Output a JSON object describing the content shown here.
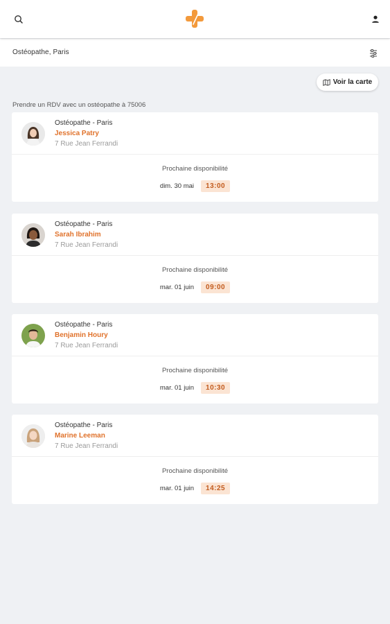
{
  "header": {
    "search_icon": "search-icon",
    "logo_icon": "medical-cross-logo",
    "user_icon": "user-icon",
    "brand_color": "#f39a3c"
  },
  "subbar": {
    "query": "Ostéopathe, Paris",
    "filter_icon": "filter-icon"
  },
  "map_button": {
    "label": "Voir la carte",
    "icon": "map-icon"
  },
  "results_label": "Prendre un RDV avec un ostéopathe à 75006",
  "availability_label": "Prochaine disponibilité",
  "cards": [
    {
      "specialty": "Ostéopathe - Paris",
      "name": "Jessica Patry",
      "address": "7 Rue Jean Ferrandi",
      "date": "dim. 30 mai",
      "slot": "13:00"
    },
    {
      "specialty": "Ostéopathe - Paris",
      "name": "Sarah Ibrahim",
      "address": "7 Rue Jean Ferrandi",
      "date": "mar. 01 juin",
      "slot": "09:00"
    },
    {
      "specialty": "Ostéopathe - Paris",
      "name": "Benjamin Houry",
      "address": "7 Rue Jean Ferrandi",
      "date": "mar. 01 juin",
      "slot": "10:30"
    },
    {
      "specialty": "Ostéopathe - Paris",
      "name": "Marine Leeman",
      "address": "7 Rue Jean Ferrandi",
      "date": "mar. 01 juin",
      "slot": "14:25"
    }
  ]
}
